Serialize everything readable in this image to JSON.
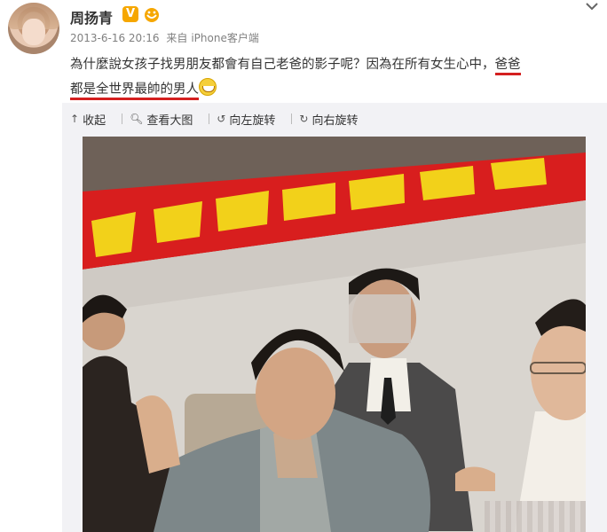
{
  "user": {
    "name": "周扬青",
    "verified_badge": "V",
    "fan_badge_icon": "fan-badge-icon",
    "time": "2013-6-16 20:16",
    "source_prefix": "来自",
    "source": "iPhone客户端"
  },
  "post": {
    "text_part1": "為什麼說女孩子找男朋友都會有自己老爸的影子呢？因為在所有女生心中，",
    "text_highlight1": "爸爸",
    "text_highlight2": "都是全世界最帥的男人",
    "emoji": "grin-emoji"
  },
  "toolbar": {
    "collapse": "收起",
    "view_large": "查看大图",
    "rotate_left": "向左旋转",
    "rotate_right": "向右旋转"
  },
  "colors": {
    "underline": "#d42020",
    "banner_red": "#d81e1e",
    "banner_text": "#f2d11a"
  },
  "icons": {
    "collapse": "collapse-arrow-icon",
    "view_large": "magnifier-icon",
    "rotate_left": "rotate-left-icon",
    "rotate_right": "rotate-right-icon",
    "more": "chevron-down-icon"
  }
}
